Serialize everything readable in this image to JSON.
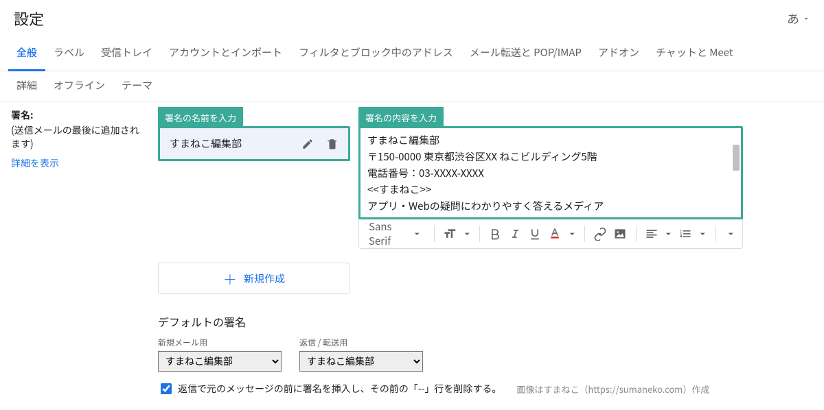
{
  "header": {
    "title": "設定",
    "lang": "あ"
  },
  "tabs": {
    "items": [
      "全般",
      "ラベル",
      "受信トレイ",
      "アカウントとインポート",
      "フィルタとブロック中のアドレス",
      "メール転送と POP/IMAP",
      "アドオン",
      "チャットと Meet"
    ],
    "active": 0
  },
  "subtabs": {
    "items": [
      "詳細",
      "オフライン",
      "テーマ"
    ]
  },
  "signature": {
    "label": "署名:",
    "sub": "(送信メールの最後に追加されます)",
    "show_more": "詳細を表示",
    "callout_name": "署名の名前を入力",
    "callout_body": "署名の内容を入力",
    "name_item": "すまねこ編集部",
    "body_lines": [
      "すまねこ編集部",
      "〒150-0000  東京都渋谷区XX ねこビルディング5階",
      "電話番号：03-XXXX-XXXX",
      "",
      "<<すまねこ>>",
      "アプリ・Webの疑問にわかりやすく答えるメディア"
    ],
    "new_label": "新規作成"
  },
  "toolbar": {
    "font": "Sans Serif"
  },
  "defaults": {
    "heading": "デフォルトの署名",
    "new_mail_label": "新規メール用",
    "reply_label": "返信 / 転送用",
    "new_mail_value": "すまねこ編集部",
    "reply_value": "すまねこ編集部",
    "checkbox_label": "返信で元のメッセージの前に署名を挿入し、その前の「--」行を削除する。",
    "checkbox_checked": true
  },
  "credit": "画像はすまねこ（https://sumaneko.com）作成"
}
